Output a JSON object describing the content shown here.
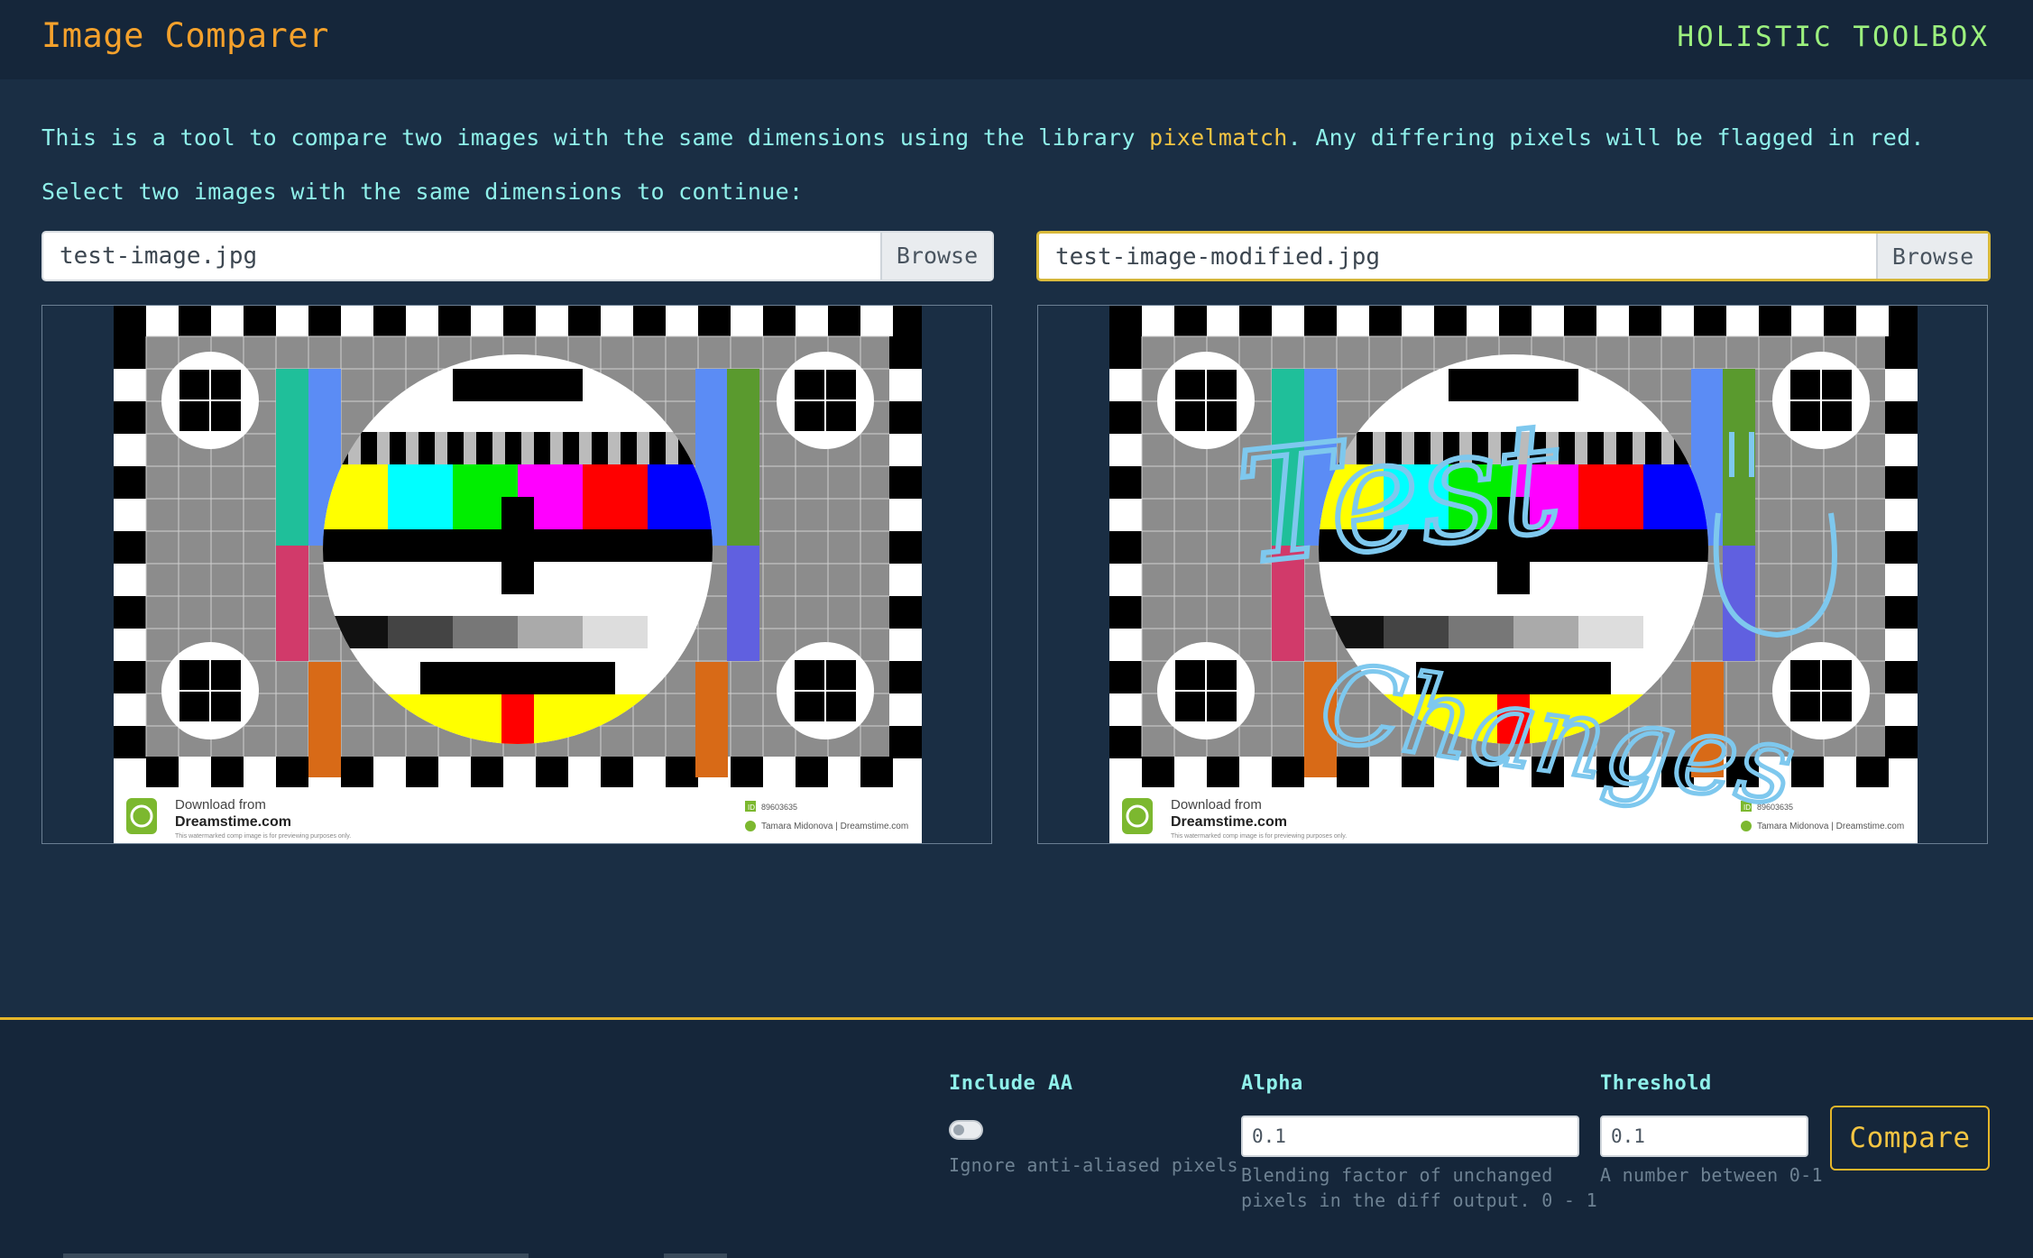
{
  "header": {
    "title": "Image Comparer",
    "brand": "HOLISTIC TOOLBOX"
  },
  "intro": {
    "before": "This is a tool to compare two images with the same dimensions using the library ",
    "library": "pixelmatch",
    "after": ". Any differing pixels will be flagged in red."
  },
  "instruction": "Select two images with the same dimensions to continue:",
  "left": {
    "filename": "test-image.jpg",
    "browse": "Browse"
  },
  "right": {
    "filename": "test-image-modified.jpg",
    "browse": "Browse"
  },
  "image": {
    "download_line1": "Download from",
    "download_line2": "Dreamstime.com",
    "fine_print": "This watermarked comp image is for previewing purposes only.",
    "id_label": "ID",
    "id_value": "89603635",
    "credit": "Tamara Midonova | Dreamstime.com",
    "annotation_line1": "Test",
    "annotation_line2": "Changes"
  },
  "options": {
    "aa": {
      "label": "Include AA",
      "hint": "Ignore anti-aliased pixels"
    },
    "alpha": {
      "label": "Alpha",
      "value": "0.1",
      "hint1": "Blending factor of unchanged",
      "hint2": "pixels in the diff output. 0 - 1"
    },
    "threshold": {
      "label": "Threshold",
      "value": "0.1",
      "hint": "A number between 0-1"
    },
    "compare": "Compare"
  },
  "colors": {
    "accent": "#f4a12c",
    "brand": "#9cf07e",
    "text": "#8ff0ea",
    "highlight": "#f5c542",
    "background": "#1a2e44"
  }
}
